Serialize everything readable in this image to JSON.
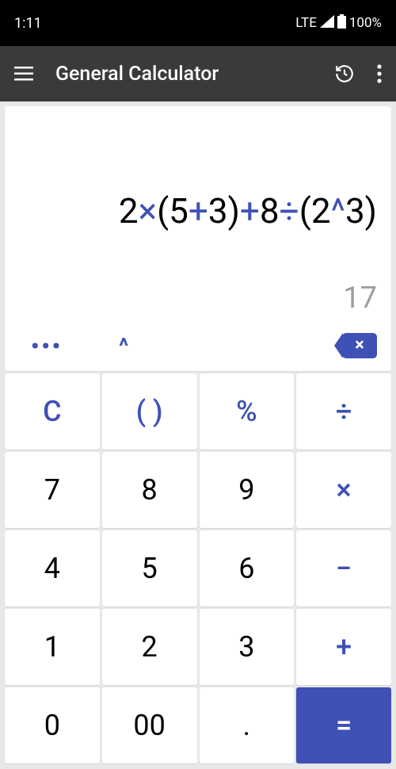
{
  "status": {
    "time": "1:11",
    "network": "LTE",
    "battery": "100%"
  },
  "appbar": {
    "title": "General Calculator"
  },
  "display": {
    "expression_tokens": [
      {
        "t": "2",
        "op": false
      },
      {
        "t": "×",
        "op": true
      },
      {
        "t": "(5",
        "op": false
      },
      {
        "t": "+",
        "op": true
      },
      {
        "t": "3)",
        "op": false
      },
      {
        "t": "+",
        "op": true
      },
      {
        "t": "8",
        "op": false
      },
      {
        "t": "÷",
        "op": true
      },
      {
        "t": "(2",
        "op": false
      },
      {
        "t": "^",
        "op": true
      },
      {
        "t": "3)",
        "op": false
      }
    ],
    "result": "17",
    "more": "•••",
    "caret": "^",
    "backspace": "×"
  },
  "keys": {
    "clear": "C",
    "paren": "( )",
    "percent": "%",
    "divide": "÷",
    "k7": "7",
    "k8": "8",
    "k9": "9",
    "multiply": "×",
    "k4": "4",
    "k5": "5",
    "k6": "6",
    "minus": "−",
    "k1": "1",
    "k2": "2",
    "k3": "3",
    "plus": "+",
    "k0": "0",
    "k00": "00",
    "dot": ".",
    "equals": "="
  }
}
